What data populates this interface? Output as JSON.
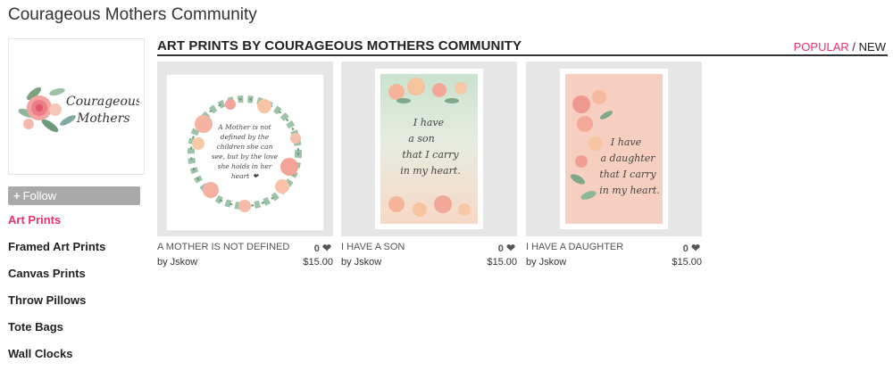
{
  "page": {
    "title": "Courageous Mothers Community"
  },
  "sidebar": {
    "logo_text_line1": "Courageous",
    "logo_text_line2": "Mothers",
    "follow_plus": "+",
    "follow_label": "Follow",
    "items": [
      {
        "label": "Art Prints",
        "active": true
      },
      {
        "label": "Framed Art Prints"
      },
      {
        "label": "Canvas Prints"
      },
      {
        "label": "Throw Pillows"
      },
      {
        "label": "Tote Bags"
      },
      {
        "label": "Wall Clocks"
      }
    ]
  },
  "main": {
    "section_title": "ART PRINTS BY COURAGEOUS MOTHERS COMMUNITY",
    "sort": {
      "popular": "POPULAR",
      "separator": "/",
      "new": "NEW"
    },
    "products": [
      {
        "name": "A MOTHER IS NOT DEFINED",
        "likes": "0",
        "by": "by Jskow",
        "price": "$15.00",
        "art_text": [
          "A Mother is not",
          "defined by the",
          "children she can",
          "see, but by the love",
          "she holds in her",
          "heart"
        ],
        "art_heart": "❤"
      },
      {
        "name": "I HAVE A SON",
        "likes": "0",
        "by": "by Jskow",
        "price": "$15.00",
        "art_text": [
          "I have",
          "a son",
          "that I carry",
          "in my heart."
        ]
      },
      {
        "name": "I HAVE A DAUGHTER",
        "likes": "0",
        "by": "by Jskow",
        "price": "$15.00",
        "art_text": [
          "I have",
          "a daughter",
          "that I carry",
          "in my heart."
        ]
      }
    ]
  },
  "icons": {
    "heart": "heart-icon",
    "plus": "plus-icon"
  },
  "colors": {
    "accent": "#e8336b",
    "follow_bg": "#a9a9a9"
  }
}
